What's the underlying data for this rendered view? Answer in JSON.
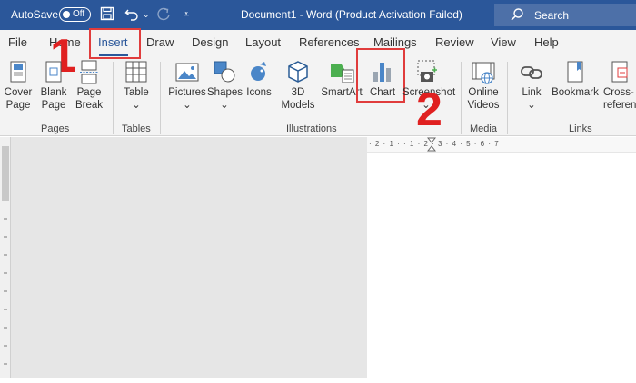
{
  "titlebar": {
    "autosave_label": "AutoSave",
    "toggle_state": "Off",
    "document_title": "Document1  -  Word (Product Activation Failed)",
    "search_label": "Search"
  },
  "tabs": [
    "File",
    "Home",
    "Insert",
    "Draw",
    "Design",
    "Layout",
    "References",
    "Mailings",
    "Review",
    "View",
    "Help"
  ],
  "active_tab": "Insert",
  "tools": {
    "cover_page": {
      "line1": "Cover",
      "line2": "Page"
    },
    "blank_page": {
      "line1": "Blank",
      "line2": "Page"
    },
    "page_break": {
      "line1": "Page",
      "line2": "Break"
    },
    "table": {
      "line1": "Table"
    },
    "pictures": {
      "line1": "Pictures"
    },
    "shapes": {
      "line1": "Shapes"
    },
    "icons": {
      "line1": "Icons"
    },
    "models3d": {
      "line1": "3D",
      "line2": "Models"
    },
    "smartart": {
      "line1": "SmartArt"
    },
    "chart": {
      "line1": "Chart"
    },
    "screenshot": {
      "line1": "Screenshot"
    },
    "online_videos": {
      "line1": "Online",
      "line2": "Videos"
    },
    "link": {
      "line1": "Link"
    },
    "bookmark": {
      "line1": "Bookmark"
    },
    "cross_reference": {
      "line1": "Cross-",
      "line2": "reference"
    }
  },
  "groups": {
    "pages": "Pages",
    "tables": "Tables",
    "illustrations": "Illustrations",
    "media": "Media",
    "links": "Links"
  },
  "annotations": {
    "step1": "1",
    "step2": "2"
  },
  "ruler": {
    "marks": "· 2 · 1 ·  · 1 · 2 · 3 · 4 · 5 · 6 · 7"
  },
  "colors": {
    "accent": "#2b579a",
    "highlight": "#e03c3c"
  }
}
